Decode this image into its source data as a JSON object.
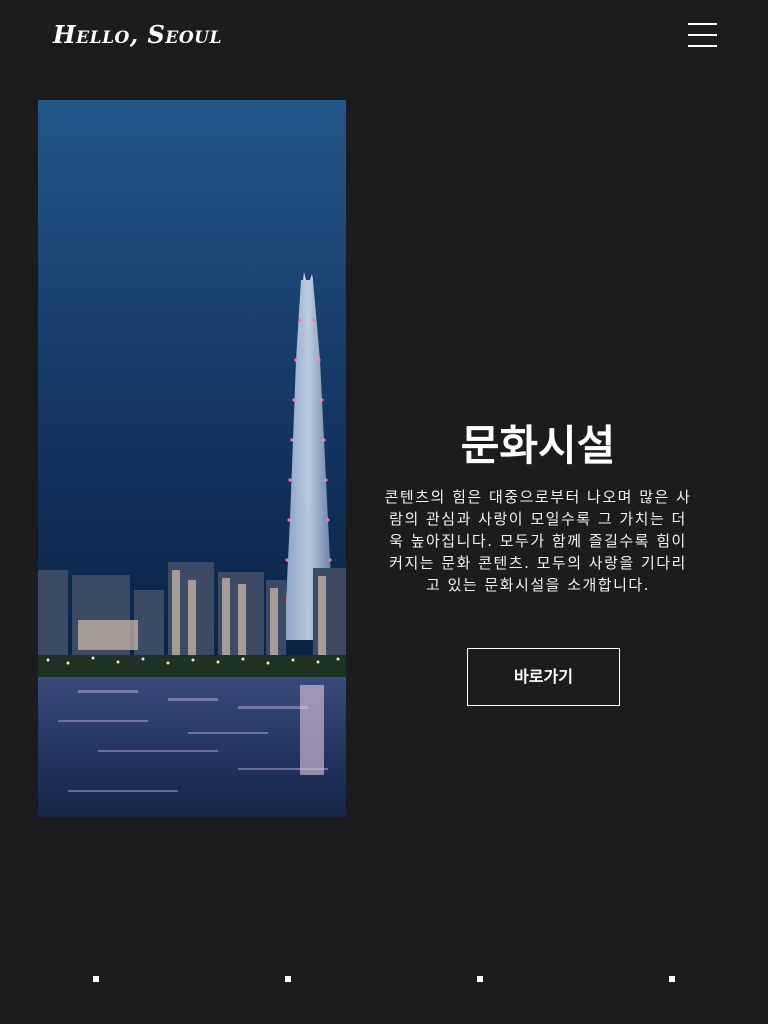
{
  "header": {
    "logo": "Hello, Seoul",
    "menu_icon": "hamburger-menu-icon"
  },
  "hero": {
    "image_subject": "night skyline with tower over river",
    "title": "문화시설",
    "description": "콘텐츠의 힘은 대중으로부터 나오며 많은 사람의 관심과 사랑이 모일수록 그 가치는 더욱 높아집니다. 모두가 함께 즐길수록 힘이 커지는 문화 콘텐츠. 모두의 사랑을 기다리고 있는 문화시설을 소개합니다.",
    "button_label": "바로가기"
  },
  "pagination": {
    "count": 4
  },
  "colors": {
    "background": "#1c1c1e",
    "text": "#ffffff",
    "sky": "#0f2a4f"
  }
}
